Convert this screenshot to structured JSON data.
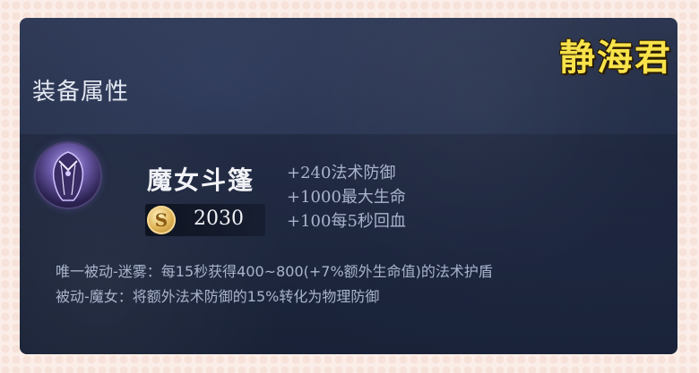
{
  "header": {
    "title": "装备属性"
  },
  "watermark": {
    "text": "静海君"
  },
  "item": {
    "name": "魔女斗篷",
    "icon": "cloak-icon",
    "price": {
      "icon": "gold-coin-icon",
      "symbol": "S",
      "value": "2030"
    },
    "stats": [
      "+240法术防御",
      "+1000最大生命",
      "+100每5秒回血"
    ],
    "passives": [
      "唯一被动-迷雾：每15秒获得400~800(+7%额外生命值)的法术护盾",
      "被动-魔女：将额外法术防御的15%转化为物理防御"
    ]
  },
  "colors": {
    "panel_bg": "#222c44",
    "title_text": "#e4e8f2",
    "stat_text": "#a9b4cc",
    "watermark": "#f7e24a",
    "gold": "#e0b356"
  }
}
